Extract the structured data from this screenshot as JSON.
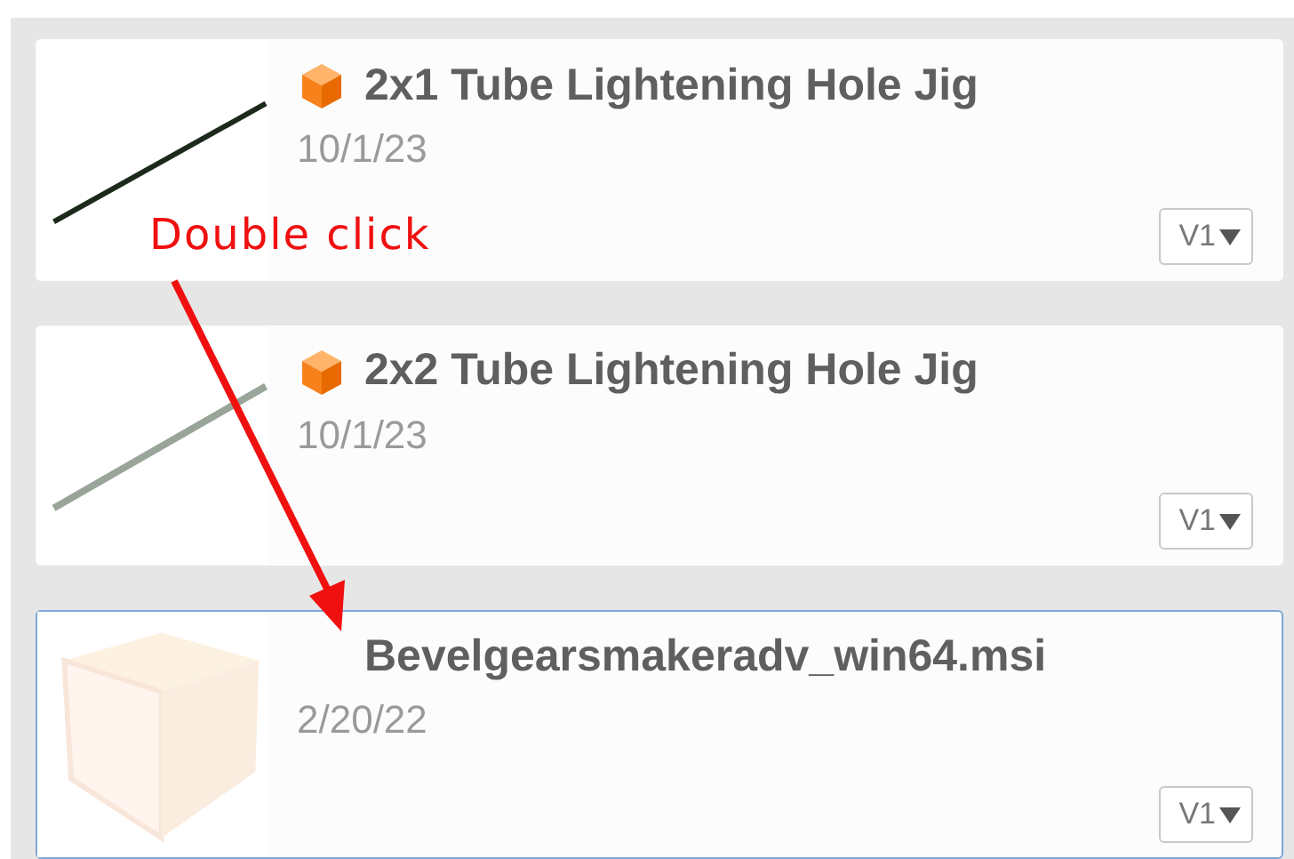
{
  "items": [
    {
      "title": "2x1 Tube Lightening Hole Jig",
      "date": "10/1/23",
      "version": "V1",
      "thumbnail": {
        "kind": "dark-line"
      },
      "part_icon": true,
      "selected": false
    },
    {
      "title": "2x2 Tube Lightening Hole Jig",
      "date": "10/1/23",
      "version": "V1",
      "thumbnail": {
        "kind": "gray-line"
      },
      "part_icon": true,
      "selected": false
    },
    {
      "title": "Bevelgearsmakeradv_win64.msi",
      "date": "2/20/22",
      "version": "V1",
      "thumbnail": {
        "kind": "faded-box"
      },
      "part_icon": false,
      "selected": true
    }
  ],
  "annotation": {
    "text": "Double click"
  }
}
